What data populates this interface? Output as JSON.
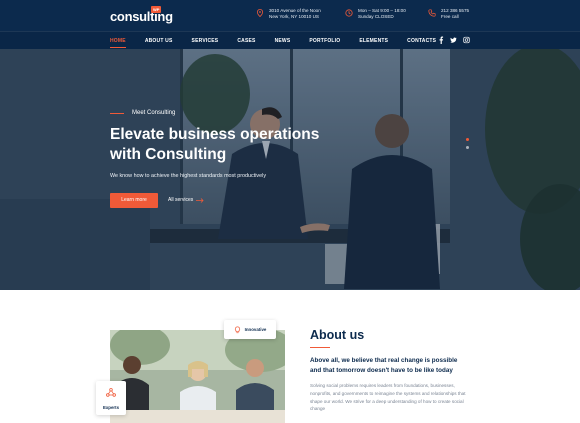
{
  "brand": {
    "name": "consulting",
    "badge": "WP"
  },
  "contact": [
    {
      "icon": "map-pin-icon",
      "line1": "3010 Avenue of the Noon",
      "line2": "New York, NY 10010 US"
    },
    {
      "icon": "clock-icon",
      "line1": "Mon – Sat 9:00 – 18:00",
      "line2": "Sunday CLOSED"
    },
    {
      "icon": "phone-icon",
      "line1": "212 386 5575",
      "line2": "Free call"
    }
  ],
  "nav": [
    "HOME",
    "ABOUT US",
    "SERVICES",
    "CASES",
    "NEWS",
    "PORTFOLIO",
    "ELEMENTS",
    "CONTACTS"
  ],
  "social": [
    "facebook-icon",
    "twitter-icon",
    "instagram-icon"
  ],
  "hero": {
    "eyebrow": "Meet Consulting",
    "title": "Elevate business operations with Consulting",
    "subtitle": "We know how to achieve the highest standards most productively",
    "primary_button": "Learn more",
    "secondary_button": "All services",
    "slides_total": 2,
    "slide_active": 1
  },
  "about": {
    "badge_innovative": "Innovative",
    "badge_experts": "Experts",
    "title": "About us",
    "lead": "Above all, we believe that real change is possible and that tomorrow doesn't have to be like today",
    "body": "Solving social problems requires leaders from foundations, businesses, nonprofits, and governments to reimagine the systems and relationships that shape our world. We strive for a deep understanding of how to create social change"
  },
  "colors": {
    "navy": "#0c2a4d",
    "accent": "#f05a38"
  }
}
